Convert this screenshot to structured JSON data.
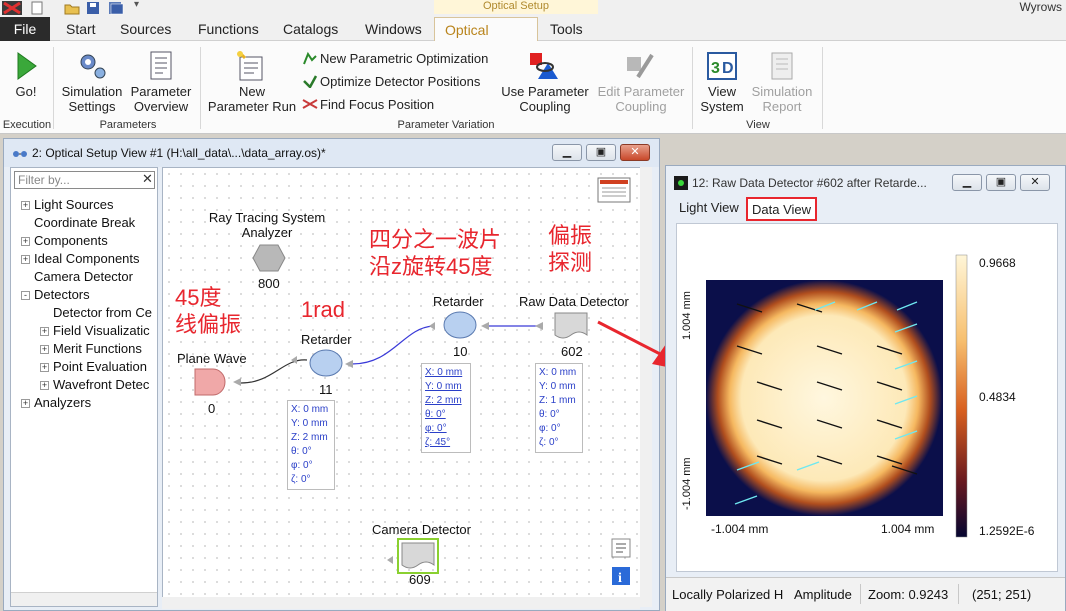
{
  "app": {
    "title": "Wyrows",
    "context_tab_group": "Optical Setup"
  },
  "menu_tabs": [
    "File",
    "Start",
    "Sources",
    "Functions",
    "Catalogs",
    "Windows",
    "Optical Setup",
    "Tools"
  ],
  "ribbon": {
    "go": "Go!",
    "simulation_settings": [
      "Simulation",
      "Settings"
    ],
    "parameter_overview": [
      "Parameter",
      "Overview"
    ],
    "new_parameter_run": [
      "New",
      "Parameter Run"
    ],
    "new_parametric_optimization": "New Parametric Optimization",
    "optimize_detector_positions": "Optimize Detector Positions",
    "find_focus_position": "Find Focus Position",
    "use_parameter_coupling": [
      "Use Parameter",
      "Coupling"
    ],
    "edit_parameter_coupling": [
      "Edit Parameter",
      "Coupling"
    ],
    "view_system": [
      "View",
      "System"
    ],
    "simulation_report": [
      "Simulation",
      "Report"
    ],
    "groups": {
      "execution": "Execution",
      "parameters": "Parameters",
      "parameter_variation": "Parameter Variation",
      "view": "View"
    }
  },
  "setup_window": {
    "title": "2: Optical Setup View #1 (H:\\all_data\\...\\data_array.os)*",
    "filter_placeholder": "Filter by...",
    "tree": [
      {
        "label": "Light Sources",
        "expander": "+"
      },
      {
        "label": "Coordinate Break",
        "expander": ""
      },
      {
        "label": "Components",
        "expander": "+"
      },
      {
        "label": "Ideal Components",
        "expander": "+"
      },
      {
        "label": "Camera Detector",
        "expander": ""
      },
      {
        "label": "Detectors",
        "expander": "-"
      },
      {
        "label": "Detector from Ce",
        "expander": ""
      },
      {
        "label": "Field Visualizatic",
        "expander": "+"
      },
      {
        "label": "Merit Functions",
        "expander": "+"
      },
      {
        "label": "Point Evaluation",
        "expander": "+"
      },
      {
        "label": "Wavefront Detec",
        "expander": "+"
      },
      {
        "label": "Analyzers",
        "expander": "+"
      }
    ],
    "nodes": {
      "analyzer": {
        "label": "Ray Tracing System\nAnalyzer",
        "id": "800"
      },
      "plane_wave": {
        "label": "Plane Wave",
        "id": "0"
      },
      "retarder1": {
        "label": "Retarder",
        "id": "11"
      },
      "retarder2": {
        "label": "Retarder",
        "id": "10"
      },
      "raw_detector": {
        "label": "Raw Data Detector",
        "id": "602"
      },
      "camera_detector": {
        "label": "Camera Detector",
        "id": "609"
      }
    },
    "coords": {
      "retarder1": [
        "X: 0 mm",
        "Y: 0 mm",
        "Z: 2 mm",
        "θ: 0°",
        "φ: 0°",
        "ζ: 0°"
      ],
      "retarder2": [
        "X: 0 mm",
        "Y: 0 mm",
        "Z: 2 mm",
        "θ: 0°",
        "φ: 0°",
        "ζ: 45°"
      ],
      "raw_detector": [
        "X: 0 mm",
        "Y: 0 mm",
        "Z: 1 mm",
        "θ: 0°",
        "φ: 0°",
        "ζ: 0°"
      ]
    },
    "annotations": {
      "quarter_wave": [
        "四分之一波片",
        "沿z旋转45度"
      ],
      "polarization_detect": [
        "偏振",
        "探测"
      ],
      "linear_45": [
        "45度",
        "线偏振"
      ],
      "one_rad": "1rad"
    }
  },
  "detector_window": {
    "title": "12: Raw Data Detector #602 after Retarde...",
    "tabs": [
      "Light View",
      "Data View"
    ],
    "active_tab": "Data View",
    "axis": {
      "y_top": "1.004 mm",
      "y_bottom": "-1.004 mm",
      "x_left": "-1.004 mm",
      "x_right": "1.004 mm"
    },
    "colorbar": {
      "max": "0.9668",
      "mid": "0.4834",
      "min": "1.2592E-6"
    },
    "status": {
      "mode": "Locally Polarized H",
      "quantity": "Amplitude",
      "zoom": "Zoom: 0.9243",
      "pixel": "(251; 251)"
    }
  },
  "colors": {
    "annotation_red": "#e8262e",
    "tab_accent": "#b9841c",
    "link_blue": "#2a3fc8"
  }
}
